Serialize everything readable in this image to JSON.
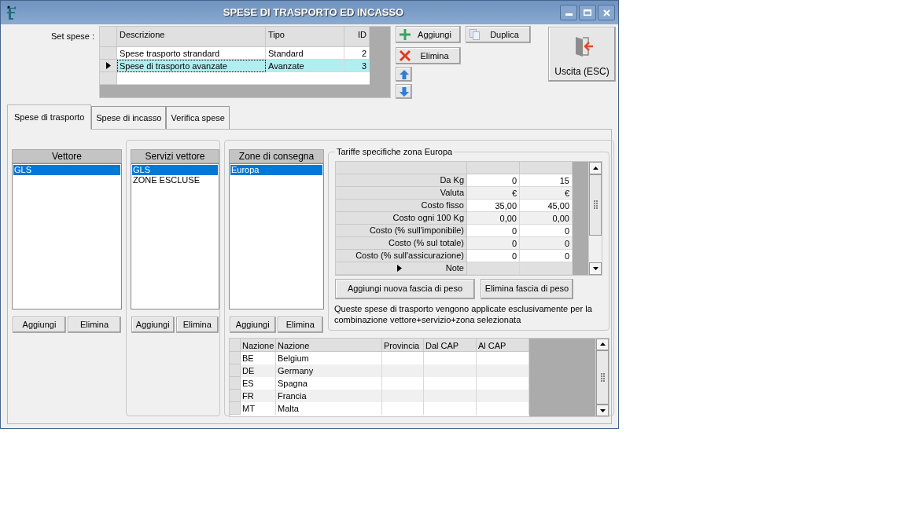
{
  "window": {
    "title": "SPESE DI TRASPORTO ED INCASSO"
  },
  "set_spese": {
    "label": "Set spese :",
    "columns": [
      "Descrizione",
      "Tipo",
      "ID"
    ],
    "rows": [
      {
        "descrizione": "Spese trasporto strandard",
        "tipo": "Standard",
        "id": "2",
        "selected": false
      },
      {
        "descrizione": "Spese di trasporto avanzate",
        "tipo": "Avanzate",
        "id": "3",
        "selected": true
      }
    ]
  },
  "set_buttons": {
    "add": "Aggiungi",
    "delete": "Elimina",
    "duplicate": "Duplica",
    "exit": "Uscita (ESC)"
  },
  "tabs": [
    {
      "label": "Spese di trasporto",
      "selected": true
    },
    {
      "label": "Spese di incasso",
      "selected": false
    },
    {
      "label": "Verifica spese",
      "selected": false
    }
  ],
  "lists": [
    {
      "header": "Vettore",
      "items": [
        {
          "label": "GLS",
          "selected": true
        }
      ],
      "buttons": [
        "Aggiungi",
        "Elimina"
      ]
    },
    {
      "header": "Servizi vettore",
      "items": [
        {
          "label": "GLS",
          "selected": true
        },
        {
          "label": "ZONE ESCLUSE",
          "selected": false
        }
      ],
      "buttons": [
        "Aggiungi",
        "Elimina"
      ]
    },
    {
      "header": "Zone di consegna",
      "items": [
        {
          "label": "Europa",
          "selected": true
        }
      ],
      "buttons": [
        "Aggiungi",
        "Elimina"
      ]
    }
  ],
  "tariffe": {
    "title": "Tariffe specifiche zona Europa",
    "rows": [
      {
        "label": "Da Kg",
        "values": [
          "0",
          "15"
        ],
        "selected": false
      },
      {
        "label": "Valuta",
        "values": [
          "€",
          "€"
        ],
        "selected": false
      },
      {
        "label": "Costo fisso",
        "values": [
          "35,00",
          "45,00"
        ],
        "selected": false
      },
      {
        "label": "Costo ogni 100 Kg",
        "values": [
          "0,00",
          "0,00"
        ],
        "selected": false
      },
      {
        "label": "Costo (% sull'imponibile)",
        "values": [
          "0",
          "0"
        ],
        "selected": false
      },
      {
        "label": "Costo (% sul totale)",
        "values": [
          "0",
          "0"
        ],
        "selected": false
      },
      {
        "label": "Costo (% sull'assicurazione)",
        "values": [
          "0",
          "0"
        ],
        "selected": false
      },
      {
        "label": "Note",
        "selected": true
      }
    ],
    "buttons": [
      "Aggiungi nuova fascia di peso",
      "Elimina fascia di peso"
    ],
    "note": "Queste spese di trasporto vengono applicate esclusivamente per la combinazione vettore+servizio+zona selezionata"
  },
  "nazioni": {
    "columns": [
      "Nazione",
      "Nazione",
      "Provincia",
      "Dal CAP",
      "Al CAP"
    ],
    "rows": [
      {
        "code": "BE",
        "name": "Belgium"
      },
      {
        "code": "DE",
        "name": "Germany"
      },
      {
        "code": "ES",
        "name": "Spagna"
      },
      {
        "code": "FR",
        "name": "Francia"
      },
      {
        "code": "MT",
        "name": "Malta"
      }
    ]
  }
}
